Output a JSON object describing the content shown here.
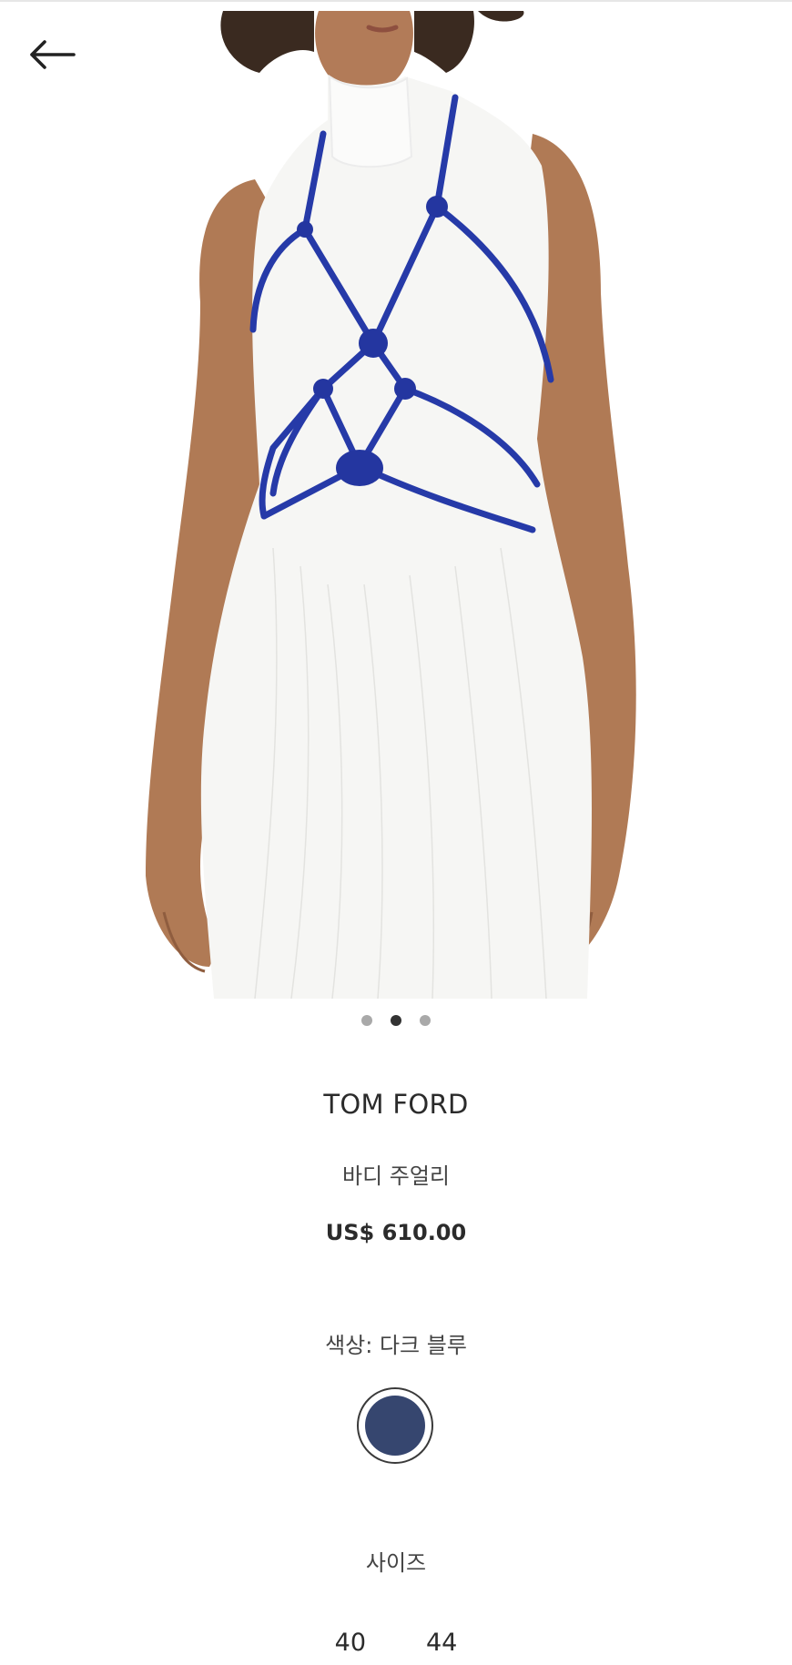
{
  "product": {
    "brand": "TOM FORD",
    "name": "바디 주얼리",
    "price": "US$ 610.00",
    "color_label": "색상: 다크 블루",
    "swatch_color": "#36466f",
    "size_title": "사이즈",
    "sizes": [
      "40",
      "44"
    ]
  },
  "gallery": {
    "image_count": 3,
    "active_index": 1
  },
  "icons": {
    "back": "arrow-left-icon"
  }
}
